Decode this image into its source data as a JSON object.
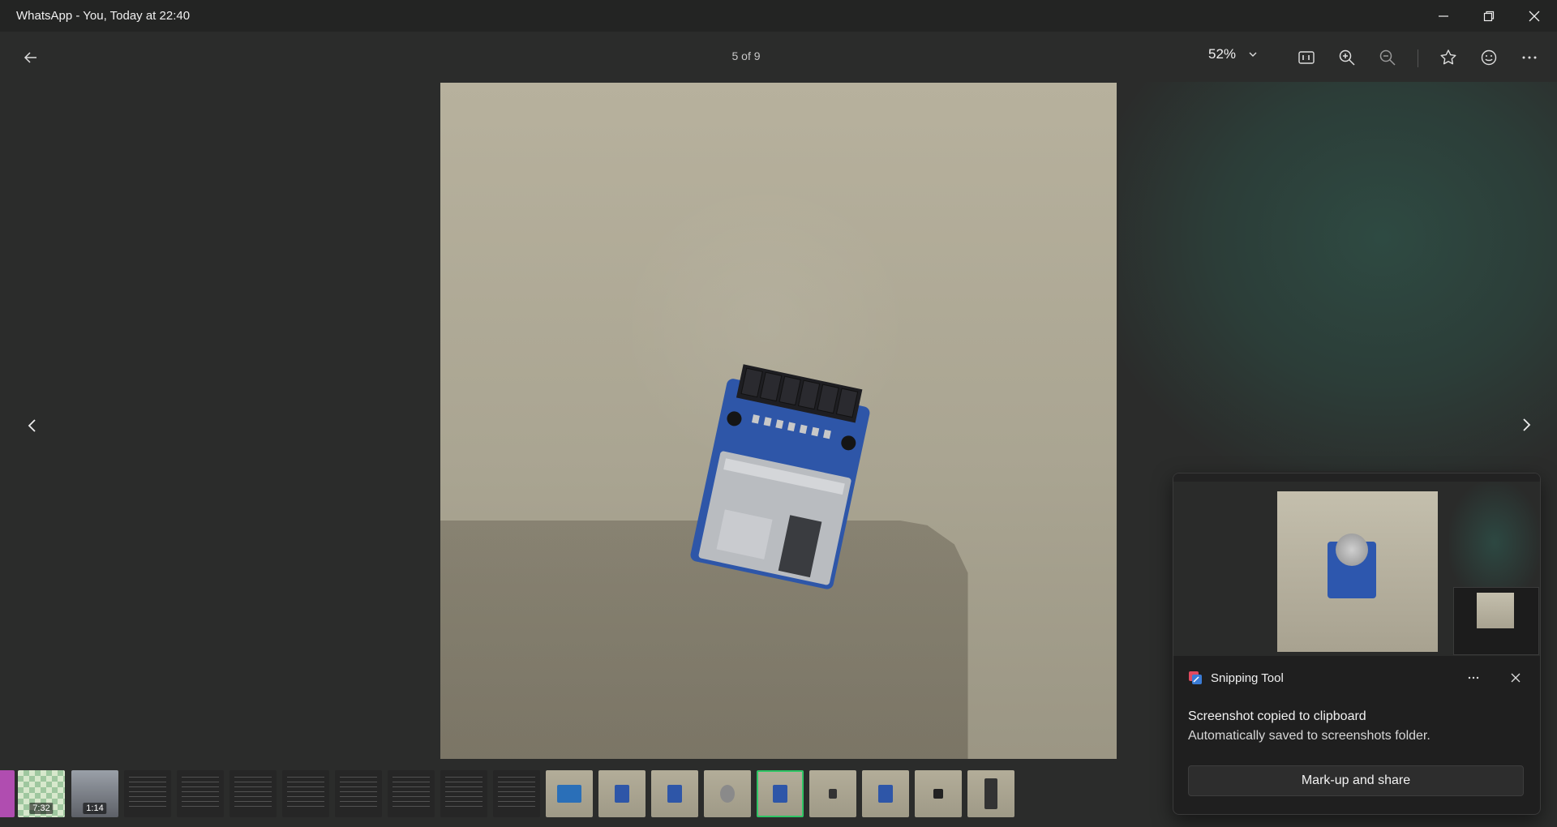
{
  "window": {
    "title": "WhatsApp - You, Today at 22:40"
  },
  "toolbar": {
    "counter": "5 of 9",
    "zoom_level": "52%"
  },
  "icons": {
    "back": "arrow-left-icon",
    "zoom_dropdown": "chevron-down-icon",
    "actual_size": "1-to-1-icon",
    "zoom_in": "zoom-in-icon",
    "zoom_out": "zoom-out-icon",
    "favorite": "star-icon",
    "reaction": "emoji-icon",
    "more": "more-icon",
    "prev": "chevron-left-icon",
    "next": "chevron-right-icon"
  },
  "filmstrip": {
    "selected_index": 14,
    "items": [
      {
        "kind": "image",
        "label": ""
      },
      {
        "kind": "video",
        "label": "7:32"
      },
      {
        "kind": "video",
        "label": "1:14"
      },
      {
        "kind": "image",
        "label": ""
      },
      {
        "kind": "image",
        "label": ""
      },
      {
        "kind": "document",
        "label": ""
      },
      {
        "kind": "document",
        "label": ""
      },
      {
        "kind": "document",
        "label": ""
      },
      {
        "kind": "document",
        "label": ""
      },
      {
        "kind": "document",
        "label": ""
      },
      {
        "kind": "photo",
        "label": ""
      },
      {
        "kind": "photo",
        "label": ""
      },
      {
        "kind": "photo",
        "label": ""
      },
      {
        "kind": "photo",
        "label": ""
      },
      {
        "kind": "photo",
        "label": ""
      },
      {
        "kind": "photo",
        "label": ""
      },
      {
        "kind": "photo",
        "label": ""
      },
      {
        "kind": "photo",
        "label": ""
      },
      {
        "kind": "photo",
        "label": ""
      }
    ]
  },
  "notification": {
    "app_name": "Snipping Tool",
    "line1": "Screenshot copied to clipboard",
    "line2": "Automatically saved to screenshots folder.",
    "action_label": "Mark-up and share"
  },
  "colors": {
    "selected_border": "#2fc565",
    "background": "#2b2c2b",
    "pcb_blue": "#2e56a8"
  }
}
